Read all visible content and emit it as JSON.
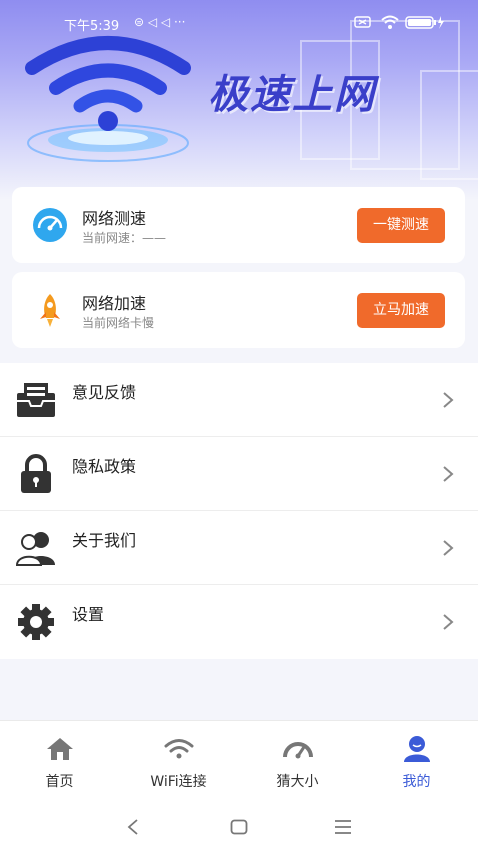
{
  "status_bar": {
    "time": "下午5:39"
  },
  "banner": {
    "title": "极速上网"
  },
  "cards": [
    {
      "title": "网络测速",
      "subtitle": "当前网速：——",
      "button": "一键测速",
      "icon": "speedometer-icon"
    },
    {
      "title": "网络加速",
      "subtitle": "当前网络卡慢",
      "button": "立马加速",
      "icon": "rocket-icon"
    }
  ],
  "menu": {
    "items": [
      {
        "label": "意见反馈",
        "icon": "feedback-inbox-icon"
      },
      {
        "label": "隐私政策",
        "icon": "lock-icon"
      },
      {
        "label": "关于我们",
        "icon": "users-icon"
      },
      {
        "label": "设置",
        "icon": "gear-icon"
      }
    ]
  },
  "tabbar": {
    "tabs": [
      {
        "label": "首页",
        "icon": "home-icon"
      },
      {
        "label": "WiFi连接",
        "icon": "wifi-icon"
      },
      {
        "label": "猜大小",
        "icon": "gauge-icon"
      },
      {
        "label": "我的",
        "icon": "profile-icon"
      }
    ],
    "active_index": 3
  },
  "colors": {
    "accent": "#3b5bd7",
    "button": "#f06a2b",
    "banner_text": "#3a3fc9"
  }
}
